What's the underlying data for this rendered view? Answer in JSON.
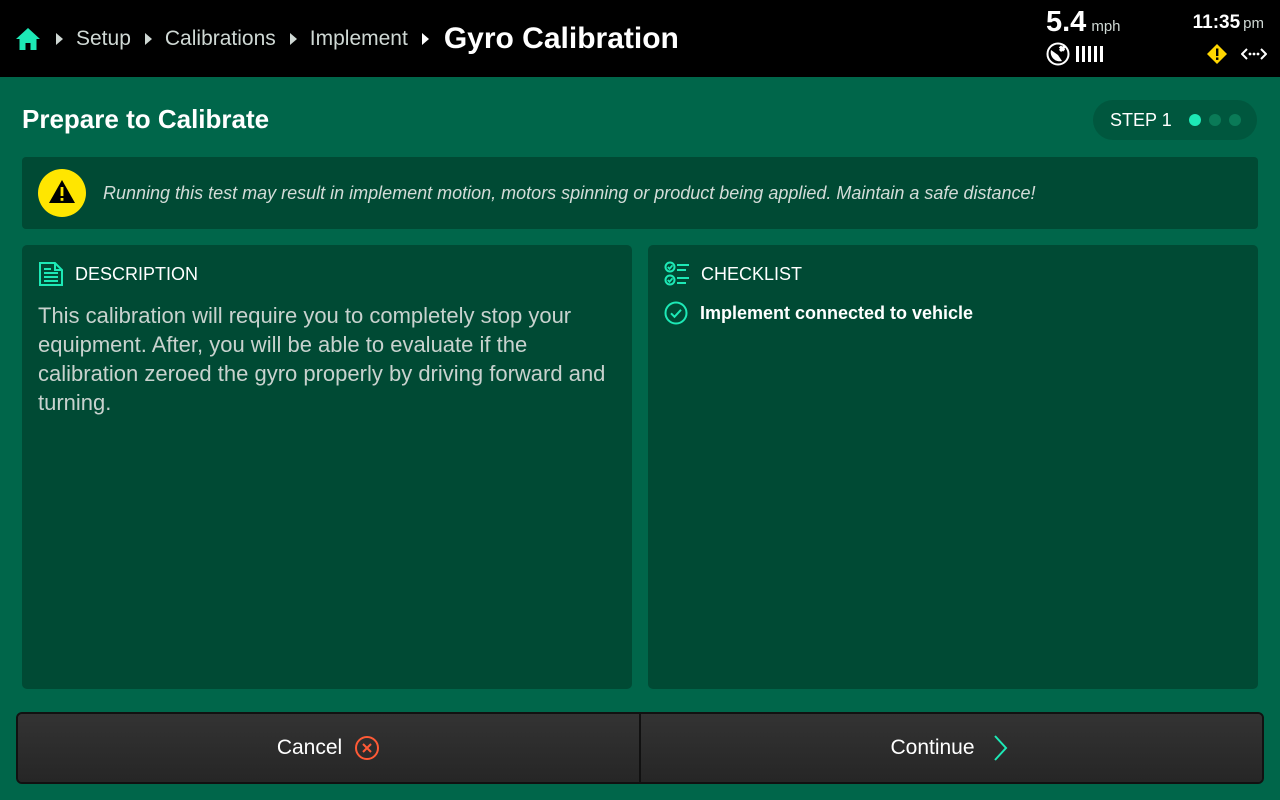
{
  "breadcrumb": {
    "items": [
      "Setup",
      "Calibrations",
      "Implement"
    ],
    "current": "Gyro Calibration"
  },
  "status": {
    "speed": "5.4",
    "speed_unit": "mph",
    "time": "11:35",
    "ampm": "pm"
  },
  "page": {
    "title": "Prepare to Calibrate",
    "step_label": "STEP 1",
    "step_current": 1,
    "step_total": 3
  },
  "warning": {
    "text": "Running this test may result in implement motion, motors spinning or product being applied. Maintain a safe distance!"
  },
  "description": {
    "heading": "DESCRIPTION",
    "body": "This calibration will require you to completely stop your equipment. After, you will be able to evaluate if the calibration zeroed the gyro properly by driving forward and turning."
  },
  "checklist": {
    "heading": "CHECKLIST",
    "items": [
      {
        "label": "Implement connected to vehicle",
        "checked": true
      }
    ]
  },
  "footer": {
    "cancel_label": "Cancel",
    "continue_label": "Continue"
  },
  "colors": {
    "accent": "#1de9b6",
    "background": "#00664a",
    "panel": "#004a34",
    "warning_yellow": "#ffe600",
    "cancel_red": "#ff5a36"
  },
  "icons": {
    "home": "home-icon",
    "gps": "gps-icon",
    "signal": "signal-bars-icon",
    "alert": "warning-diamond-icon",
    "connection": "connection-arrows-icon",
    "warning": "warning-triangle-icon",
    "description": "document-icon",
    "checklist": "checklist-icon",
    "check": "check-circle-icon",
    "cancel": "close-circle-icon",
    "continue": "chevron-right-icon"
  }
}
